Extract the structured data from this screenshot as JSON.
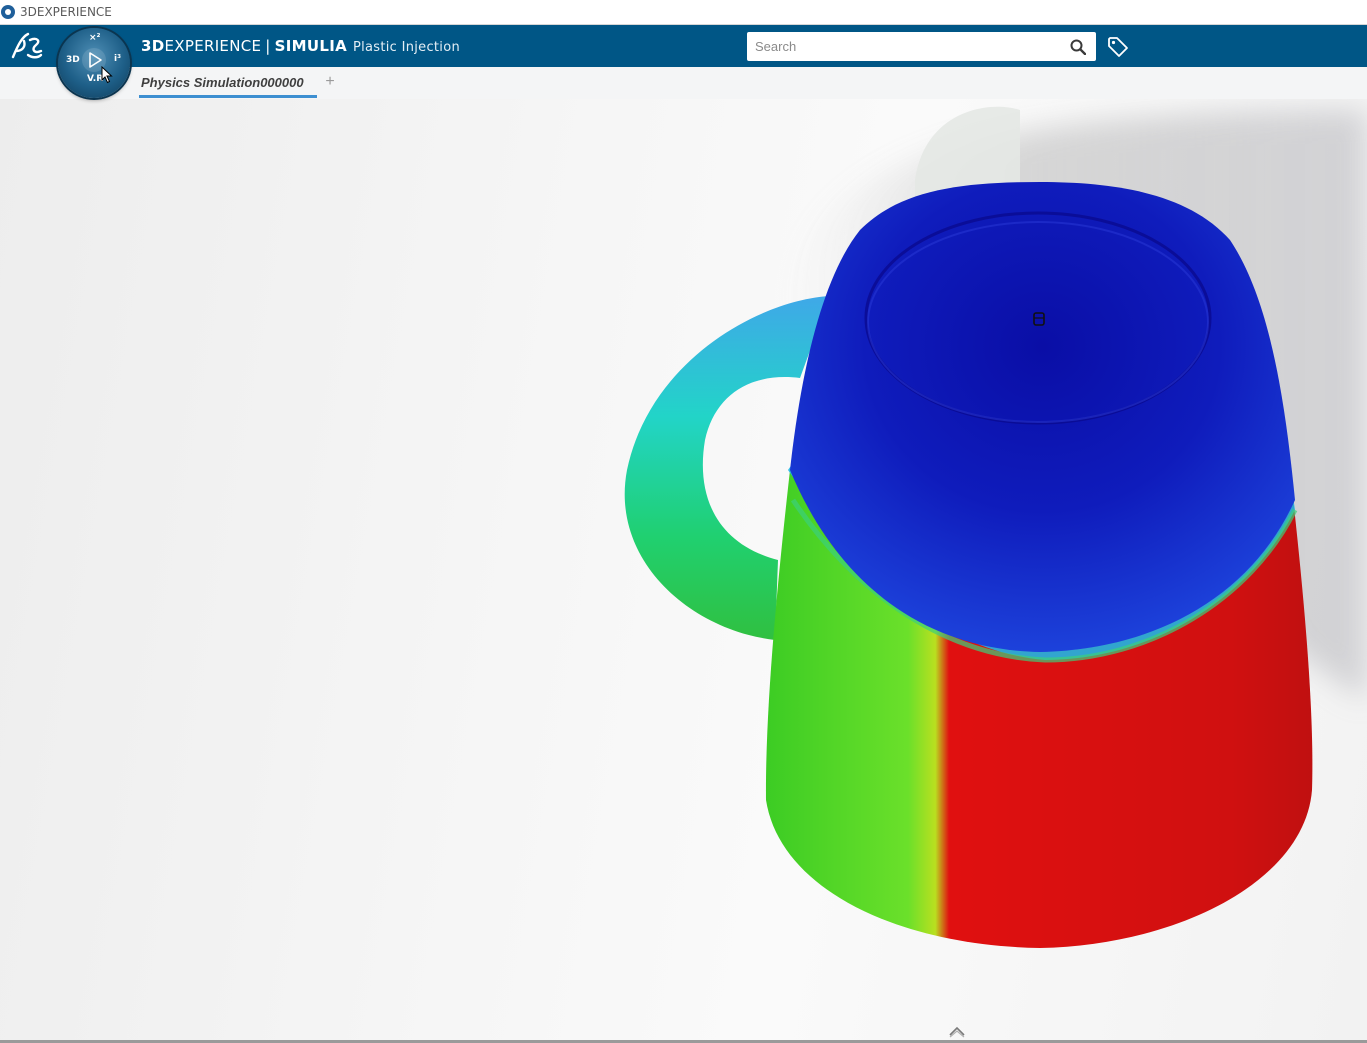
{
  "window": {
    "title": "3DEXPERIENCE",
    "icon": "3dexperience-app-icon"
  },
  "header": {
    "logo_icon": "dassault-systemes-logo-icon",
    "brand_prefix": "3D",
    "brand_suffix": "EXPERIENCE",
    "separator": "|",
    "brand_product": "SIMULIA",
    "app_name": "Plastic Injection",
    "search": {
      "value": "",
      "placeholder": "Search",
      "icon": "search-icon"
    },
    "tag_icon": "tag-icon",
    "compass": {
      "top_label": "×²",
      "left_label": "3D",
      "right_label": "i³",
      "bottom_label": "V.R",
      "center_icon": "play-icon"
    }
  },
  "tabs": {
    "items": [
      {
        "label": "Physics Simulation000000",
        "active": true
      }
    ],
    "add_label": "+"
  },
  "viewport": {
    "model": "mug-3d-model",
    "result_colors": {
      "top": "#1a2fd0",
      "band": "#1aa0e0",
      "handle": "#2fd8a0",
      "left": "#4dd22a",
      "right": "#e01010"
    },
    "toggle_icon": "chevron-up-icon"
  },
  "colors": {
    "header_bg": "#005686",
    "tab_accent": "#3d8fd1"
  }
}
